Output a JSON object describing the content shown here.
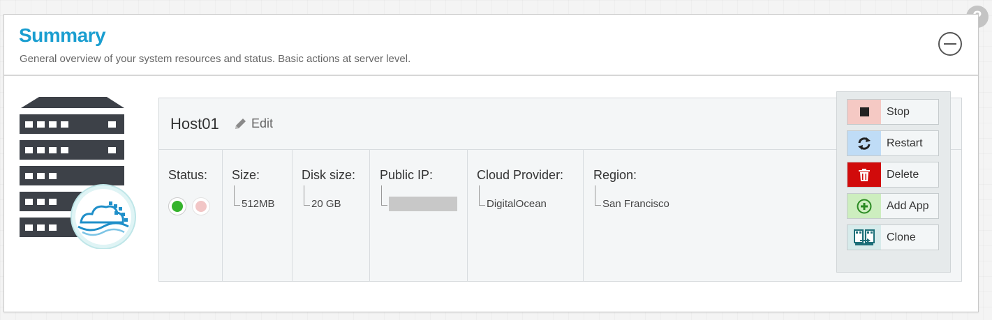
{
  "panel": {
    "title": "Summary",
    "subtitle": "General overview of your system resources and status. Basic actions at server level."
  },
  "host": {
    "name": "Host01",
    "edit_label": "Edit",
    "columns": [
      {
        "label": "Status:"
      },
      {
        "label": "Size:",
        "value": "512MB"
      },
      {
        "label": "Disk size:",
        "value": "20 GB"
      },
      {
        "label": "Public IP:",
        "value": ""
      },
      {
        "label": "Cloud Provider:",
        "value": "DigitalOcean"
      },
      {
        "label": "Region:",
        "value": "San Francisco"
      }
    ],
    "status": {
      "running": true
    }
  },
  "actions": [
    {
      "label": "Stop",
      "icon": "stop-icon",
      "color": "#f5c9c4"
    },
    {
      "label": "Restart",
      "icon": "restart-icon",
      "color": "#bfdcf6"
    },
    {
      "label": "Delete",
      "icon": "trash-icon",
      "color": "#d10b0b"
    },
    {
      "label": "Add App",
      "icon": "add-icon",
      "color": "#cdeebf"
    },
    {
      "label": "Clone",
      "icon": "clone-icon",
      "color": "#d7ebeb"
    }
  ],
  "colors": {
    "title": "#1a9ed0",
    "status_on": "#35b32c",
    "status_off": "#f2c6c6"
  }
}
